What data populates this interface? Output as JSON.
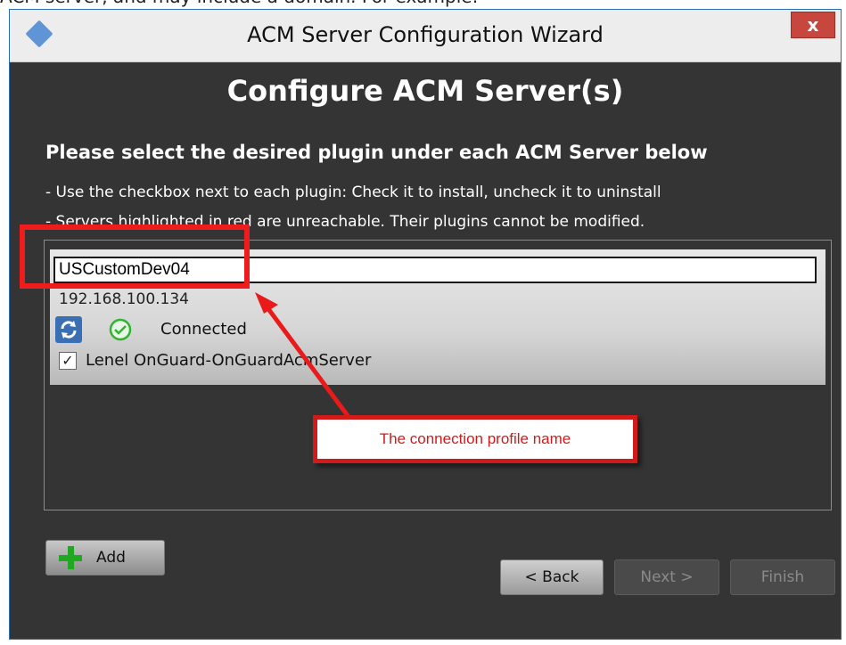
{
  "doc_text": "ACM server, and may include a domain. For example:",
  "window": {
    "title": "ACM Server Configuration Wizard",
    "close_label": "x",
    "app_icon": "diamond-icon"
  },
  "header": {
    "title": "Configure ACM Server(s)",
    "subtitle": "Please select the desired plugin under each ACM Server below",
    "instructions": [
      "- Use the checkbox next to each plugin: Check it to install, uncheck it to uninstall",
      "- Servers highlighted in red are unreachable. Their plugins cannot be modified."
    ]
  },
  "servers": [
    {
      "name": "USCustomDev04",
      "ip": "192.168.100.134",
      "status": "Connected",
      "status_icon": "check-circle-icon",
      "refresh_icon": "refresh-icon",
      "plugins": [
        {
          "label": "Lenel OnGuard-OnGuardAcmServer",
          "checked": true
        }
      ]
    }
  ],
  "annotation": {
    "callout_text": "The connection profile name",
    "color": "#d11a1a"
  },
  "buttons": {
    "add": "Add",
    "back": "< Back",
    "next": "Next >",
    "finish": "Finish"
  }
}
